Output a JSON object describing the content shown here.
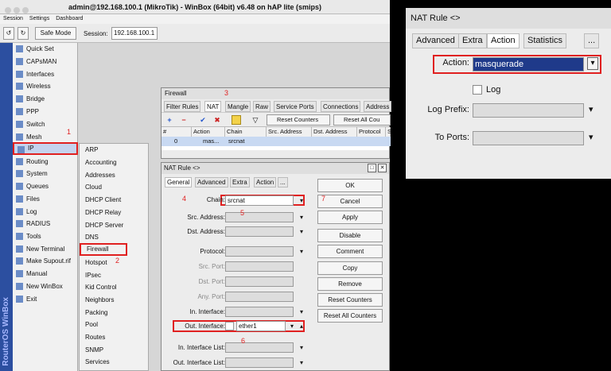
{
  "window": {
    "title": "admin@192.168.100.1 (MikroTik) - WinBox (64bit) v6.48 on hAP lite (smips)"
  },
  "menubar": [
    "Session",
    "Settings",
    "Dashboard"
  ],
  "toolbar": {
    "safe_mode": "Safe Mode",
    "session_label": "Session:",
    "session_value": "192.168.100.1"
  },
  "sidebar_brand": "RouterOS WinBox",
  "main_menu": [
    "Quick Set",
    "CAPsMAN",
    "Interfaces",
    "Wireless",
    "Bridge",
    "PPP",
    "Switch",
    "Mesh",
    "IP",
    "Routing",
    "System",
    "Queues",
    "Files",
    "Log",
    "RADIUS",
    "Tools",
    "New Terminal",
    "Make Supout.rif",
    "Manual",
    "New WinBox",
    "Exit"
  ],
  "ip_submenu": [
    "ARP",
    "Accounting",
    "Addresses",
    "Cloud",
    "DHCP Client",
    "DHCP Relay",
    "DHCP Server",
    "DNS",
    "Firewall",
    "Hotspot",
    "IPsec",
    "Kid Control",
    "Neighbors",
    "Packing",
    "Pool",
    "Routes",
    "SNMP",
    "Services"
  ],
  "firewall": {
    "title": "Firewall",
    "tabs": [
      "Filter Rules",
      "NAT",
      "Mangle",
      "Raw",
      "Service Ports",
      "Connections",
      "Address"
    ],
    "reset_counters": "Reset Counters",
    "reset_all_counters": "Reset All Cou",
    "columns": [
      "#",
      "Action",
      "Chain",
      "Src. Address",
      "Dst. Address",
      "Protocol",
      "S"
    ],
    "row": {
      "num": "0",
      "action": "mas...",
      "chain": "srcnat"
    }
  },
  "nat_dialog": {
    "title": "NAT Rule <>",
    "tabs": [
      "General",
      "Advanced",
      "Extra",
      "Action",
      "..."
    ],
    "fields": {
      "chain_label": "Chain:",
      "chain_value": "srcnat",
      "src_address": "Src. Address:",
      "dst_address": "Dst. Address:",
      "protocol": "Protocol:",
      "src_port": "Src. Port:",
      "dst_port": "Dst. Port:",
      "any_port": "Any. Port:",
      "in_interface": "In. Interface:",
      "out_interface_label": "Out. Interface:",
      "out_interface_value": "ether1",
      "in_interface_list": "In. Interface List:",
      "out_interface_list": "Out. Interface List:"
    },
    "buttons": [
      "OK",
      "Cancel",
      "Apply",
      "Disable",
      "Comment",
      "Copy",
      "Remove",
      "Reset Counters",
      "Reset All Counters"
    ]
  },
  "action_panel": {
    "title": "NAT Rule <>",
    "tabs": [
      "Advanced",
      "Extra",
      "Action",
      "Statistics",
      "..."
    ],
    "action_label": "Action:",
    "action_value": "masquerade",
    "log_label": "Log",
    "log_prefix_label": "Log Prefix:",
    "to_ports_label": "To Ports:"
  },
  "step_numbers": [
    "1",
    "2",
    "3",
    "4",
    "5",
    "6",
    "7"
  ]
}
